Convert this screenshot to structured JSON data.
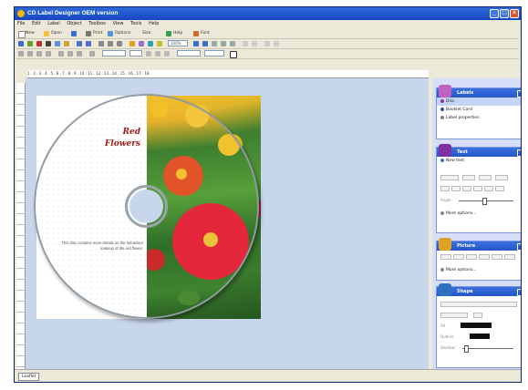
{
  "window": {
    "title": "CD Label Designer OEM version"
  },
  "menu": [
    "File",
    "Edit",
    "Label",
    "Object",
    "Toolbox",
    "View",
    "Tools",
    "Help"
  ],
  "toolbar1": {
    "new": "New",
    "open": "Open",
    "print": "Print",
    "options": "Options",
    "zoom": "Size",
    "help": "Help",
    "font": "Font"
  },
  "zoom": {
    "value": "100%"
  },
  "ruler": {
    "marks": "1 . 2 . 3 . 4 . 5 . 6 . 7 . 8 . 9 . 10 . 11 . 12 . 13 . 14 . 15 . 16 . 17 . 18"
  },
  "document": {
    "title_line1": "Red",
    "title_line2": "Flowers",
    "caption": "This disc contains more details on the behaviour makeup of the red flower."
  },
  "bottom": {
    "tab": "Leaflet"
  },
  "panels": {
    "labels": {
      "title": "Labels",
      "items": [
        "Disc",
        "Booklet Card",
        "Label properties"
      ]
    },
    "text": {
      "title": "Text",
      "new_text": "New text",
      "angle": "Angle",
      "more": "More options..."
    },
    "picture": {
      "title": "Picture",
      "more": "More options..."
    },
    "shape": {
      "title": "Shape",
      "fill": "Fill",
      "outline": "Outline",
      "shadow": "Shadow"
    }
  },
  "colors": {
    "title_bar": "#2456c8",
    "canvas": "#c8d6ec",
    "title_text": "#9c1a1a"
  }
}
